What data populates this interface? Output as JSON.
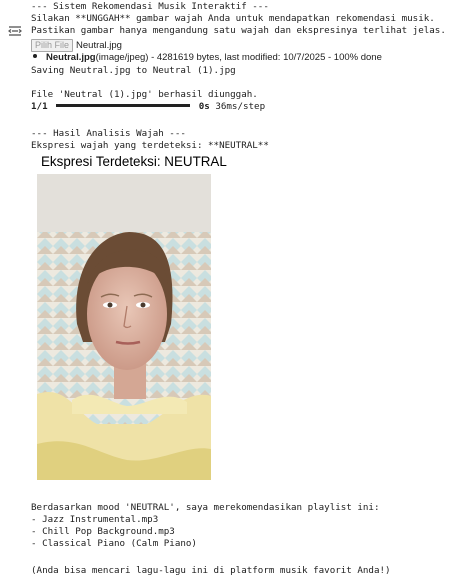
{
  "output": {
    "lines": [
      "--- Sistem Rekomendasi Musik Interaktif ---",
      "Silakan **UNGGAH** gambar wajah Anda untuk mendapatkan rekomendasi musik.",
      "Pastikan gambar hanya mengandung satu wajah dan ekspresinya terlihat jelas."
    ],
    "upload": {
      "button_label": "Pilih File",
      "file_name": "Neutral.jpg"
    },
    "file_info": {
      "name": "Neutral.jpg",
      "details": "(image/jpeg) - 4281619 bytes, last modified: 10/7/2025 - 100% done"
    },
    "saving_line": "Saving Neutral.jpg to Neutral (1).jpg",
    "uploaded_line": "File 'Neutral (1).jpg' berhasil diunggah.",
    "progress": {
      "step": "1/1",
      "fraction": 1.0,
      "time": "0s",
      "rate": "36ms/step"
    },
    "analysis_header": "--- Hasil Analisis Wajah ---",
    "expression_line": "Ekspresi wajah yang terdeteksi: **NEUTRAL**",
    "figure_title": "Ekspresi Terdeteksi: NEUTRAL",
    "recommend_intro": "Berdasarkan mood 'NEUTRAL', saya merekomendasikan playlist ini:",
    "playlist": [
      "- Jazz Instrumental.mp3",
      "- Chill Pop Background.mp3",
      "- Classical Piano (Calm Piano)"
    ],
    "footer_note": "(Anda bisa mencari lagu-lagu ini di platform musik favorit Anda!)"
  }
}
